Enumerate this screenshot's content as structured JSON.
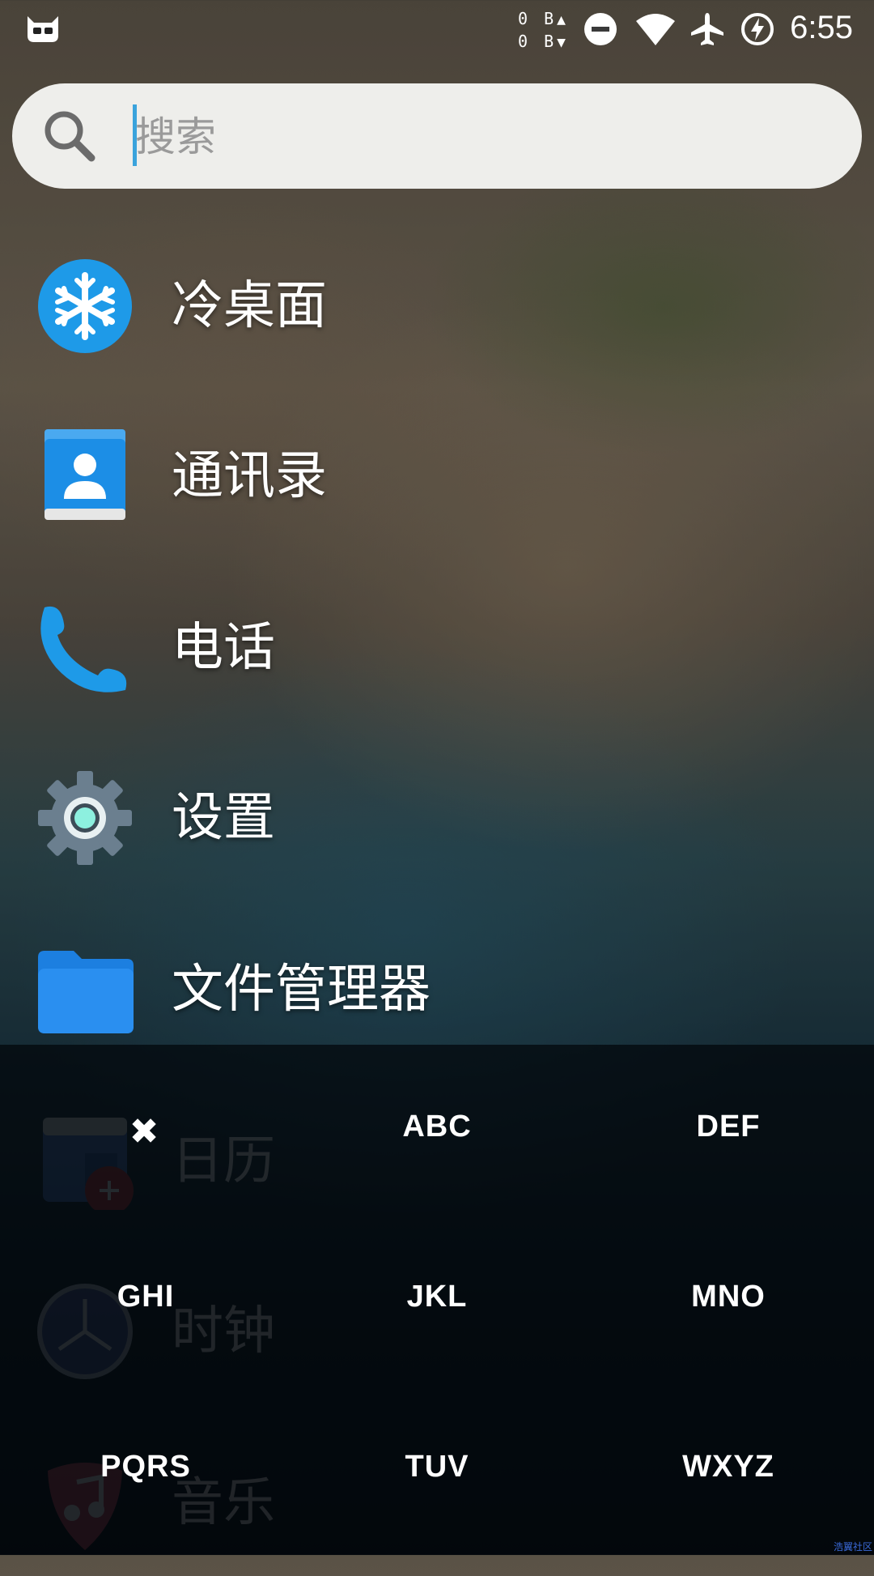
{
  "status_bar": {
    "net_up": "0 B",
    "net_down": "0 B",
    "time": "6:55",
    "icons": [
      "cyanogen-mascot-icon",
      "dnd-icon",
      "wifi-icon",
      "airplane-icon",
      "battery-charging-icon"
    ]
  },
  "search": {
    "placeholder": "搜索",
    "value": ""
  },
  "apps": [
    {
      "label": "冷桌面",
      "icon": "snowflake-icon"
    },
    {
      "label": "通讯录",
      "icon": "contacts-icon"
    },
    {
      "label": "电话",
      "icon": "phone-icon"
    },
    {
      "label": "设置",
      "icon": "settings-gear-icon"
    },
    {
      "label": "文件管理器",
      "icon": "folder-icon"
    },
    {
      "label": "日历",
      "icon": "calendar-icon"
    },
    {
      "label": "时钟",
      "icon": "clock-icon"
    },
    {
      "label": "音乐",
      "icon": "music-icon"
    }
  ],
  "keypad": {
    "close": "✖",
    "keys": [
      "",
      "ABC",
      "DEF",
      "GHI",
      "JKL",
      "MNO",
      "PQRS",
      "TUV",
      "WXYZ"
    ]
  },
  "watermark": "浩翼社区",
  "colors": {
    "accent": "#3aa3dc",
    "search_bg": "#f5f5f2",
    "keypad_bg": "#02060a"
  }
}
